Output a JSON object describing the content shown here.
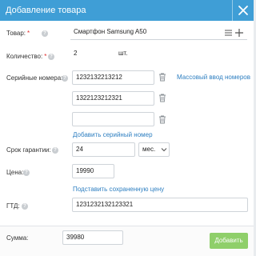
{
  "header": {
    "title": "Добавление товара",
    "close_icon": "close-icon"
  },
  "product": {
    "label": "Товар:",
    "required_mark": "*",
    "value": "Смартфон Samsung A50"
  },
  "quantity": {
    "label": "Количество:",
    "required_mark": "*",
    "value": "2",
    "unit": "шт."
  },
  "serials": {
    "label": "Серийные номера:",
    "items": [
      "1232132213212",
      "1322123212321",
      ""
    ],
    "bulk_link": "Массовый ввод номеров",
    "add_link": "Добавить серийный номер"
  },
  "warranty": {
    "label": "Срок гарантии:",
    "value": "24",
    "unit_selected": "мес."
  },
  "price": {
    "label": "Цена:",
    "value": "19990",
    "saved_price_link": "Подставить сохраненную цену"
  },
  "gtd": {
    "label": "ГТД:",
    "value": "1231232132123321"
  },
  "footer": {
    "sum_label": "Сумма:",
    "sum_value": "39980",
    "add_button": "Добавить"
  },
  "colors": {
    "header": "#3f9ed6",
    "link": "#2e7fc1",
    "required": "#e02b2b",
    "button": "#8fcf6a"
  }
}
